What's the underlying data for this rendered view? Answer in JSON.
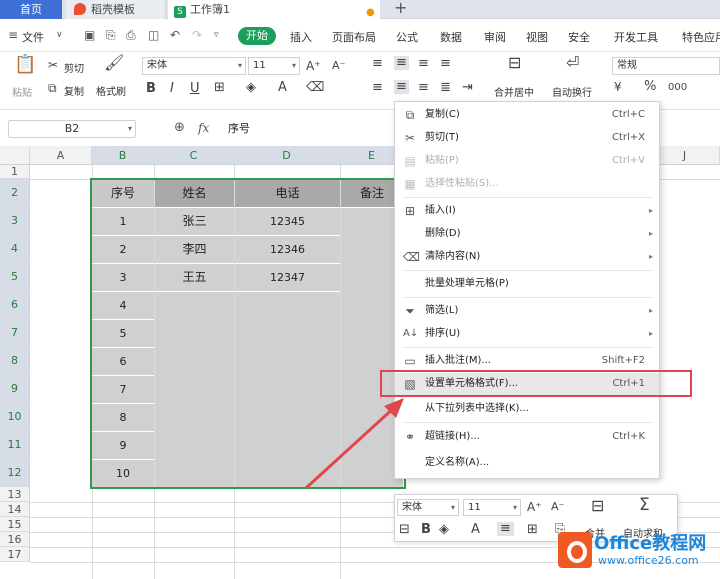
{
  "tabs": {
    "home": "首页",
    "template": "稻壳模板",
    "workbook": "工作簿1",
    "workbook_logo": "S",
    "new_tab": "+"
  },
  "menu": {
    "file": "文件",
    "start": "开始",
    "items": [
      "插入",
      "页面布局",
      "公式",
      "数据",
      "审阅",
      "视图",
      "安全",
      "开发工具",
      "特色应用"
    ]
  },
  "ribbon": {
    "paste": "粘贴",
    "cut": "剪切",
    "copy": "复制",
    "format_painter": "格式刷",
    "font_name": "宋体",
    "font_size": "11",
    "merge_center": "合并居中",
    "wrap_text": "自动换行",
    "number_format": "常规",
    "currency": "¥",
    "percent": "%",
    "thousands": "000"
  },
  "formula": {
    "cell_ref": "B2",
    "fx": "fx",
    "content": "序号"
  },
  "columns": [
    "A",
    "B",
    "C",
    "D",
    "E",
    "J"
  ],
  "rows": [
    "1",
    "2",
    "3",
    "4",
    "5",
    "6",
    "7",
    "8",
    "9",
    "10",
    "11",
    "12",
    "13",
    "14",
    "15",
    "16",
    "17"
  ],
  "table": {
    "headers": [
      "序号",
      "姓名",
      "电话",
      "备注"
    ],
    "rows": [
      [
        "1",
        "张三",
        "12345"
      ],
      [
        "2",
        "李四",
        "12346"
      ],
      [
        "3",
        "王五",
        "12347"
      ],
      [
        "4",
        "",
        ""
      ],
      [
        "5",
        "",
        ""
      ],
      [
        "6",
        "",
        ""
      ],
      [
        "7",
        "",
        ""
      ],
      [
        "8",
        "",
        ""
      ],
      [
        "9",
        "",
        ""
      ],
      [
        "10",
        "",
        ""
      ]
    ]
  },
  "context_menu": {
    "copy": {
      "label": "复制(C)",
      "shortcut": "Ctrl+C"
    },
    "cut": {
      "label": "剪切(T)",
      "shortcut": "Ctrl+X"
    },
    "paste": {
      "label": "粘贴(P)",
      "shortcut": "Ctrl+V"
    },
    "paste_special": {
      "label": "选择性粘贴(S)..."
    },
    "insert": {
      "label": "插入(I)"
    },
    "delete": {
      "label": "删除(D)"
    },
    "clear": {
      "label": "清除内容(N)"
    },
    "batch": {
      "label": "批量处理单元格(P)"
    },
    "filter": {
      "label": "筛选(L)"
    },
    "sort": {
      "label": "排序(U)"
    },
    "comment": {
      "label": "插入批注(M)...",
      "shortcut": "Shift+F2"
    },
    "format_cells": {
      "label": "设置单元格格式(F)...",
      "shortcut": "Ctrl+1"
    },
    "pick_list": {
      "label": "从下拉列表中选择(K)..."
    },
    "hyperlink": {
      "label": "超链接(H)...",
      "shortcut": "Ctrl+K"
    },
    "define_name": {
      "label": "定义名称(A)..."
    }
  },
  "mini_toolbar": {
    "font_name": "宋体",
    "font_size": "11",
    "merge": "合并",
    "autosum": "自动求和"
  },
  "watermark": {
    "title": "Office教程网",
    "url": "www.office26.com"
  },
  "colors": {
    "accent_green": "#1aa05a",
    "selection_border": "#2e9a4a",
    "highlight_red": "#e0474c",
    "tab_blue": "#3d6fd6"
  }
}
